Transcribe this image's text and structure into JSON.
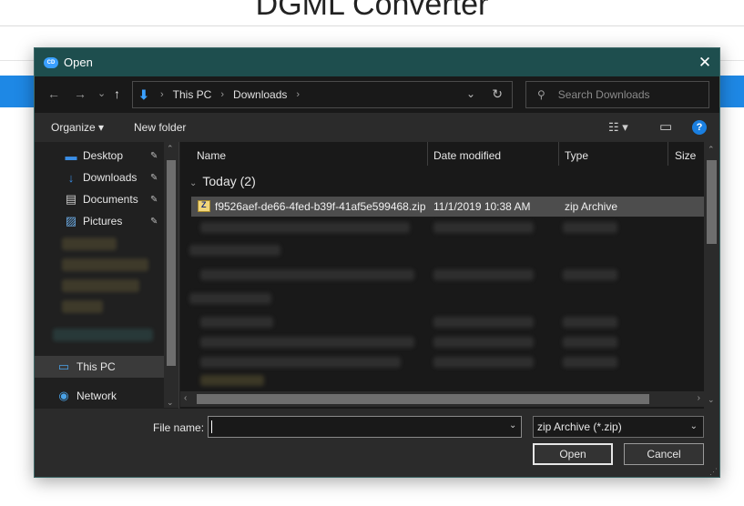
{
  "background": {
    "title": "DGML Converter"
  },
  "dialog": {
    "title": "Open",
    "app_icon_text": "CD",
    "close_glyph": "✕"
  },
  "nav": {
    "back": "←",
    "forward": "→",
    "recent": "⌄",
    "up": "↑",
    "breadcrumbs": [
      "This PC",
      "Downloads"
    ],
    "breadcrumb_sep": "›",
    "dropdown": "⌄",
    "refresh": "↻",
    "search_placeholder": "Search Downloads",
    "search_icon": "⚲"
  },
  "toolbar": {
    "organize": "Organize ▾",
    "new_folder": "New folder",
    "view_icon": "☷ ▾",
    "preview_icon": "▭",
    "help": "?"
  },
  "sidebar": {
    "items": [
      {
        "label": "Desktop",
        "icon": "desktop-icon",
        "glyph": "▬",
        "color": "#3a8ee6",
        "pinned": true
      },
      {
        "label": "Downloads",
        "icon": "download-icon",
        "glyph": "↓",
        "color": "#3a8ee6",
        "pinned": true
      },
      {
        "label": "Documents",
        "icon": "document-icon",
        "glyph": "▤",
        "color": "#c7c7c7",
        "pinned": true
      },
      {
        "label": "Pictures",
        "icon": "pictures-icon",
        "glyph": "▨",
        "color": "#6aa8e0",
        "pinned": true
      },
      {
        "label": "This PC",
        "icon": "computer-icon",
        "glyph": "▭",
        "color": "#4aa3e8",
        "selected": true
      },
      {
        "label": "Network",
        "icon": "network-icon",
        "glyph": "◉",
        "color": "#4aa3e8"
      }
    ],
    "pin_glyph": "📌"
  },
  "file_list": {
    "columns": {
      "name": "Name",
      "date": "Date modified",
      "type": "Type",
      "size": "Size"
    },
    "group": {
      "label": "Today (2)",
      "chevron": "⌄"
    },
    "selected_file": {
      "name": "f9526aef-de66-4fed-b39f-41af5e599468.zip",
      "date": "11/1/2019 10:38 AM",
      "type": "zip Archive"
    }
  },
  "footer": {
    "file_name_label": "File name:",
    "file_name_value": "",
    "file_type": "zip Archive (*.zip)",
    "open": "Open",
    "cancel": "Cancel",
    "dropdown_glyph": "⌄"
  },
  "colors": {
    "titlebar": "#1e4e4e",
    "accent": "#1a7fe0",
    "selection": "#4d4d4d"
  }
}
